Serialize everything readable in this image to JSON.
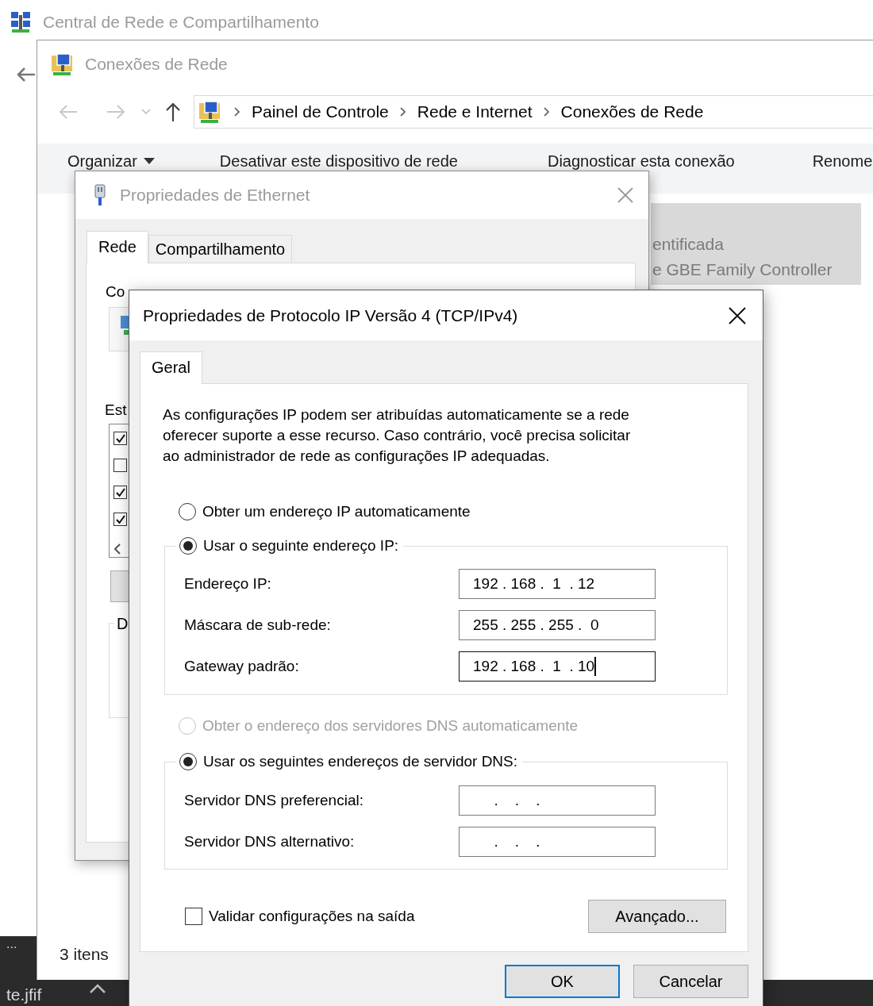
{
  "central_window": {
    "title": "Central de Rede e Compartilhamento"
  },
  "explorer": {
    "title": "Conexões de Rede",
    "breadcrumb": [
      "Painel de Controle",
      "Rede e Internet",
      "Conexões de Rede"
    ],
    "commands": [
      {
        "label": "Organizar",
        "kind": "menu"
      },
      {
        "label": "Desativar este dispositivo de rede",
        "kind": "action"
      },
      {
        "label": "Diagnosticar esta conexão",
        "kind": "action"
      },
      {
        "label": "Renome",
        "kind": "action"
      }
    ],
    "selected_item": [
      "entificada",
      "e GBE Family Controller"
    ],
    "status_bar": "3 itens"
  },
  "taskbar": {
    "overflow": "...",
    "file": "te.jfif"
  },
  "ethernet_dialog": {
    "title": "Propriedades de Ethernet",
    "tabs": [
      {
        "label": "Rede",
        "selected": true
      },
      {
        "label": "Compartilhamento",
        "selected": false
      }
    ],
    "connect_label": "Co",
    "components_label": "Est",
    "components": [
      {
        "checked": true
      },
      {
        "checked": false
      },
      {
        "checked": true
      },
      {
        "checked": true
      }
    ],
    "description_label": "D"
  },
  "ipv4_dialog": {
    "title": "Propriedades de Protocolo IP Versão 4 (TCP/IPv4)",
    "tabs": [
      {
        "label": "Geral",
        "selected": true
      }
    ],
    "intro": "As configurações IP podem ser atribuídas automaticamente se a rede\noferecer suporte a esse recurso. Caso contrário, você precisa solicitar\nao administrador de rede as configurações IP adequadas.",
    "ip_auto": {
      "label": "Obter um endereço IP automaticamente",
      "selected": false,
      "disabled": false
    },
    "ip_manual": {
      "label": "Usar o seguinte endereço IP:",
      "selected": true,
      "disabled": false
    },
    "ip_fields": [
      {
        "label": "Endereço IP:",
        "value": "192 . 168 .  1  . 12",
        "focused": false
      },
      {
        "label": "Máscara de sub-rede:",
        "value": "255 . 255 . 255 .  0",
        "focused": false
      },
      {
        "label": "Gateway padrão:",
        "value": "192 . 168 .  1  . 10",
        "focused": true
      }
    ],
    "dns_auto": {
      "label": "Obter o endereço dos servidores DNS automaticamente",
      "selected": false,
      "disabled": true
    },
    "dns_manual": {
      "label": "Usar os seguintes endereços de servidor DNS:",
      "selected": true,
      "disabled": false
    },
    "dns_fields": [
      {
        "label": "Servidor DNS preferencial:",
        "value": "     .    .    .",
        "focused": false
      },
      {
        "label": "Servidor DNS alternativo:",
        "value": "     .    .    .",
        "focused": false
      }
    ],
    "validate": {
      "label": "Validar configurações na saída",
      "checked": false
    },
    "advanced_button": "Avançado...",
    "buttons": [
      {
        "label": "OK",
        "default": true
      },
      {
        "label": "Cancelar",
        "default": false
      }
    ]
  }
}
